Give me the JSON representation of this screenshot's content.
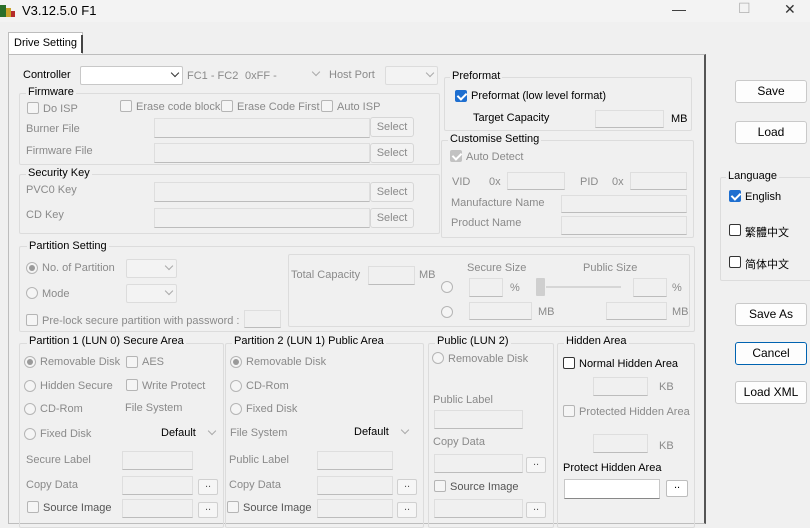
{
  "window": {
    "title": "V3.12.5.0 F1",
    "minimize": "—",
    "maximize": "☐",
    "close": "✕"
  },
  "tab": {
    "label": "Drive Setting"
  },
  "controller": {
    "label": "Controller",
    "fc_label": "FC1 - FC2",
    "fc_value": "0xFF -",
    "host_port_label": "Host Port"
  },
  "firmware": {
    "title": "Firmware",
    "do_isp": "Do ISP",
    "erase_code_block": "Erase code block",
    "erase_code_first": "Erase Code First",
    "auto_isp": "Auto ISP",
    "burner_file": "Burner File",
    "firmware_file": "Firmware File",
    "select": "Select"
  },
  "security_key": {
    "title": "Security Key",
    "pvc0_key": "PVC0 Key",
    "cd_key": "CD Key",
    "select": "Select"
  },
  "preformat": {
    "title": "Preformat",
    "option": "Preformat (low level format)",
    "target_capacity": "Target Capacity",
    "unit": "MB"
  },
  "customise": {
    "title": "Customise Setting",
    "auto_detect": "Auto Detect",
    "vid": "VID",
    "pid": "PID",
    "hex": "0x",
    "manufacture_name": "Manufacture Name",
    "product_name": "Product Name"
  },
  "partition": {
    "title": "Partition Setting",
    "no_of_partition": "No. of Partition",
    "mode": "Mode",
    "prelock": "Pre-lock secure partition with password :",
    "total_capacity": "Total Capacity",
    "mb": "MB",
    "secure_size": "Secure Size",
    "public_size": "Public Size",
    "pct": "%"
  },
  "p1": {
    "title": "Partition 1 (LUN 0) Secure Area",
    "removable": "Removable Disk",
    "aes": "AES",
    "hidden_secure": "Hidden Secure",
    "write_protect": "Write Protect",
    "cdrom": "CD-Rom",
    "file_system": "File System",
    "fixed_disk": "Fixed Disk",
    "fs_value": "Default",
    "secure_label": "Secure Label",
    "copy_data": "Copy Data",
    "source_image": "Source Image",
    "dots": ".."
  },
  "p2": {
    "title": "Partition 2 (LUN 1) Public Area",
    "removable": "Removable Disk",
    "cdrom": "CD-Rom",
    "fixed_disk": "Fixed Disk",
    "file_system": "File System",
    "fs_value": "Default",
    "public_label": "Public Label",
    "copy_data": "Copy Data",
    "source_image": "Source Image",
    "dots": ".."
  },
  "public_lun2": {
    "title": "Public (LUN 2)",
    "removable": "Removable Disk",
    "public_label": "Public Label",
    "copy_data": "Copy Data",
    "source_image": "Source Image",
    "dots": ".."
  },
  "hidden": {
    "title": "Hidden Area",
    "normal": "Normal Hidden Area",
    "kb": "KB",
    "protected": "Protected Hidden Area",
    "protect_title": "Protect Hidden Area",
    "dots": ".."
  },
  "buttons": {
    "save": "Save",
    "load": "Load",
    "save_as": "Save As",
    "cancel": "Cancel",
    "load_xml": "Load XML"
  },
  "language": {
    "title": "Language",
    "english": "English",
    "traditional": "繁體中文",
    "simplified": "简体中文"
  }
}
